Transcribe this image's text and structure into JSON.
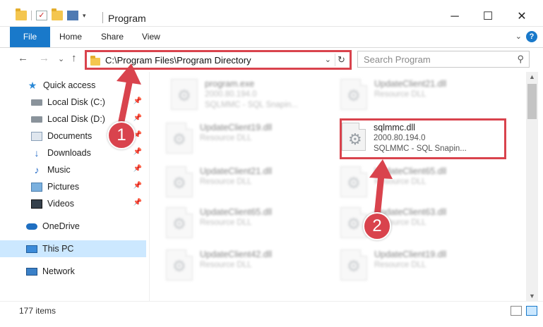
{
  "window": {
    "title": "Program",
    "controls": {
      "minimize": "─",
      "maximize": "☐",
      "close": "✕"
    }
  },
  "ribbon": {
    "tabs": [
      "File",
      "Home",
      "Share",
      "View"
    ],
    "expand": "⌄",
    "help": "?"
  },
  "nav": {
    "back": "←",
    "forward": "→",
    "recent": "⌄",
    "up": "↑",
    "address": "C:\\Program Files\\Program Directory",
    "search_placeholder": "Search Program"
  },
  "sidebar": {
    "items": [
      {
        "label": "Quick access",
        "icon": "star-icon",
        "pinned": false
      },
      {
        "label": "Local Disk (C:)",
        "icon": "disk-icon",
        "pinned": true
      },
      {
        "label": "Local Disk (D:)",
        "icon": "disk-icon",
        "pinned": true
      },
      {
        "label": "Documents",
        "icon": "documents-icon",
        "pinned": true
      },
      {
        "label": "Downloads",
        "icon": "download-icon",
        "pinned": true
      },
      {
        "label": "Music",
        "icon": "music-icon",
        "pinned": true
      },
      {
        "label": "Pictures",
        "icon": "pictures-icon",
        "pinned": true
      },
      {
        "label": "Videos",
        "icon": "videos-icon",
        "pinned": true
      },
      {
        "label": "OneDrive",
        "icon": "cloud-icon",
        "pinned": false
      },
      {
        "label": "This PC",
        "icon": "pc-icon",
        "pinned": false
      },
      {
        "label": "Network",
        "icon": "network-icon",
        "pinned": false
      }
    ]
  },
  "files": [
    {
      "name": "program.exe",
      "line2": "2000.80.194.0",
      "line3": "SQLMMC - SQL Snapin...",
      "focus": false
    },
    {
      "name": "UpdateClient21.dll",
      "line2": "Resource DLL",
      "line3": "",
      "focus": false
    },
    {
      "name": "UpdateClient19.dll",
      "line2": "Resource DLL",
      "line3": "",
      "focus": false
    },
    {
      "name": "sqlmmc.dll",
      "line2": "2000.80.194.0",
      "line3": "SQLMMC - SQL Snapin...",
      "focus": true
    },
    {
      "name": "UpdateClient21.dll",
      "line2": "Resource DLL",
      "line3": "",
      "focus": false
    },
    {
      "name": "UpdateClient65.dll",
      "line2": "Resource DLL",
      "line3": "",
      "focus": false
    },
    {
      "name": "UpdateClient65.dll",
      "line2": "Resource DLL",
      "line3": "",
      "focus": false
    },
    {
      "name": "UpdateClient63.dll",
      "line2": "Resource DLL",
      "line3": "",
      "focus": false
    },
    {
      "name": "UpdateClient42.dll",
      "line2": "Resource DLL",
      "line3": "",
      "focus": false
    },
    {
      "name": "UpdateClient19.dll",
      "line2": "Resource DLL",
      "line3": "",
      "focus": false
    }
  ],
  "status": {
    "count": "177 items"
  },
  "callouts": {
    "one": "1",
    "two": "2"
  },
  "colors": {
    "accent": "#1979ca",
    "highlight": "#d9434d",
    "selection": "#cce8ff"
  }
}
